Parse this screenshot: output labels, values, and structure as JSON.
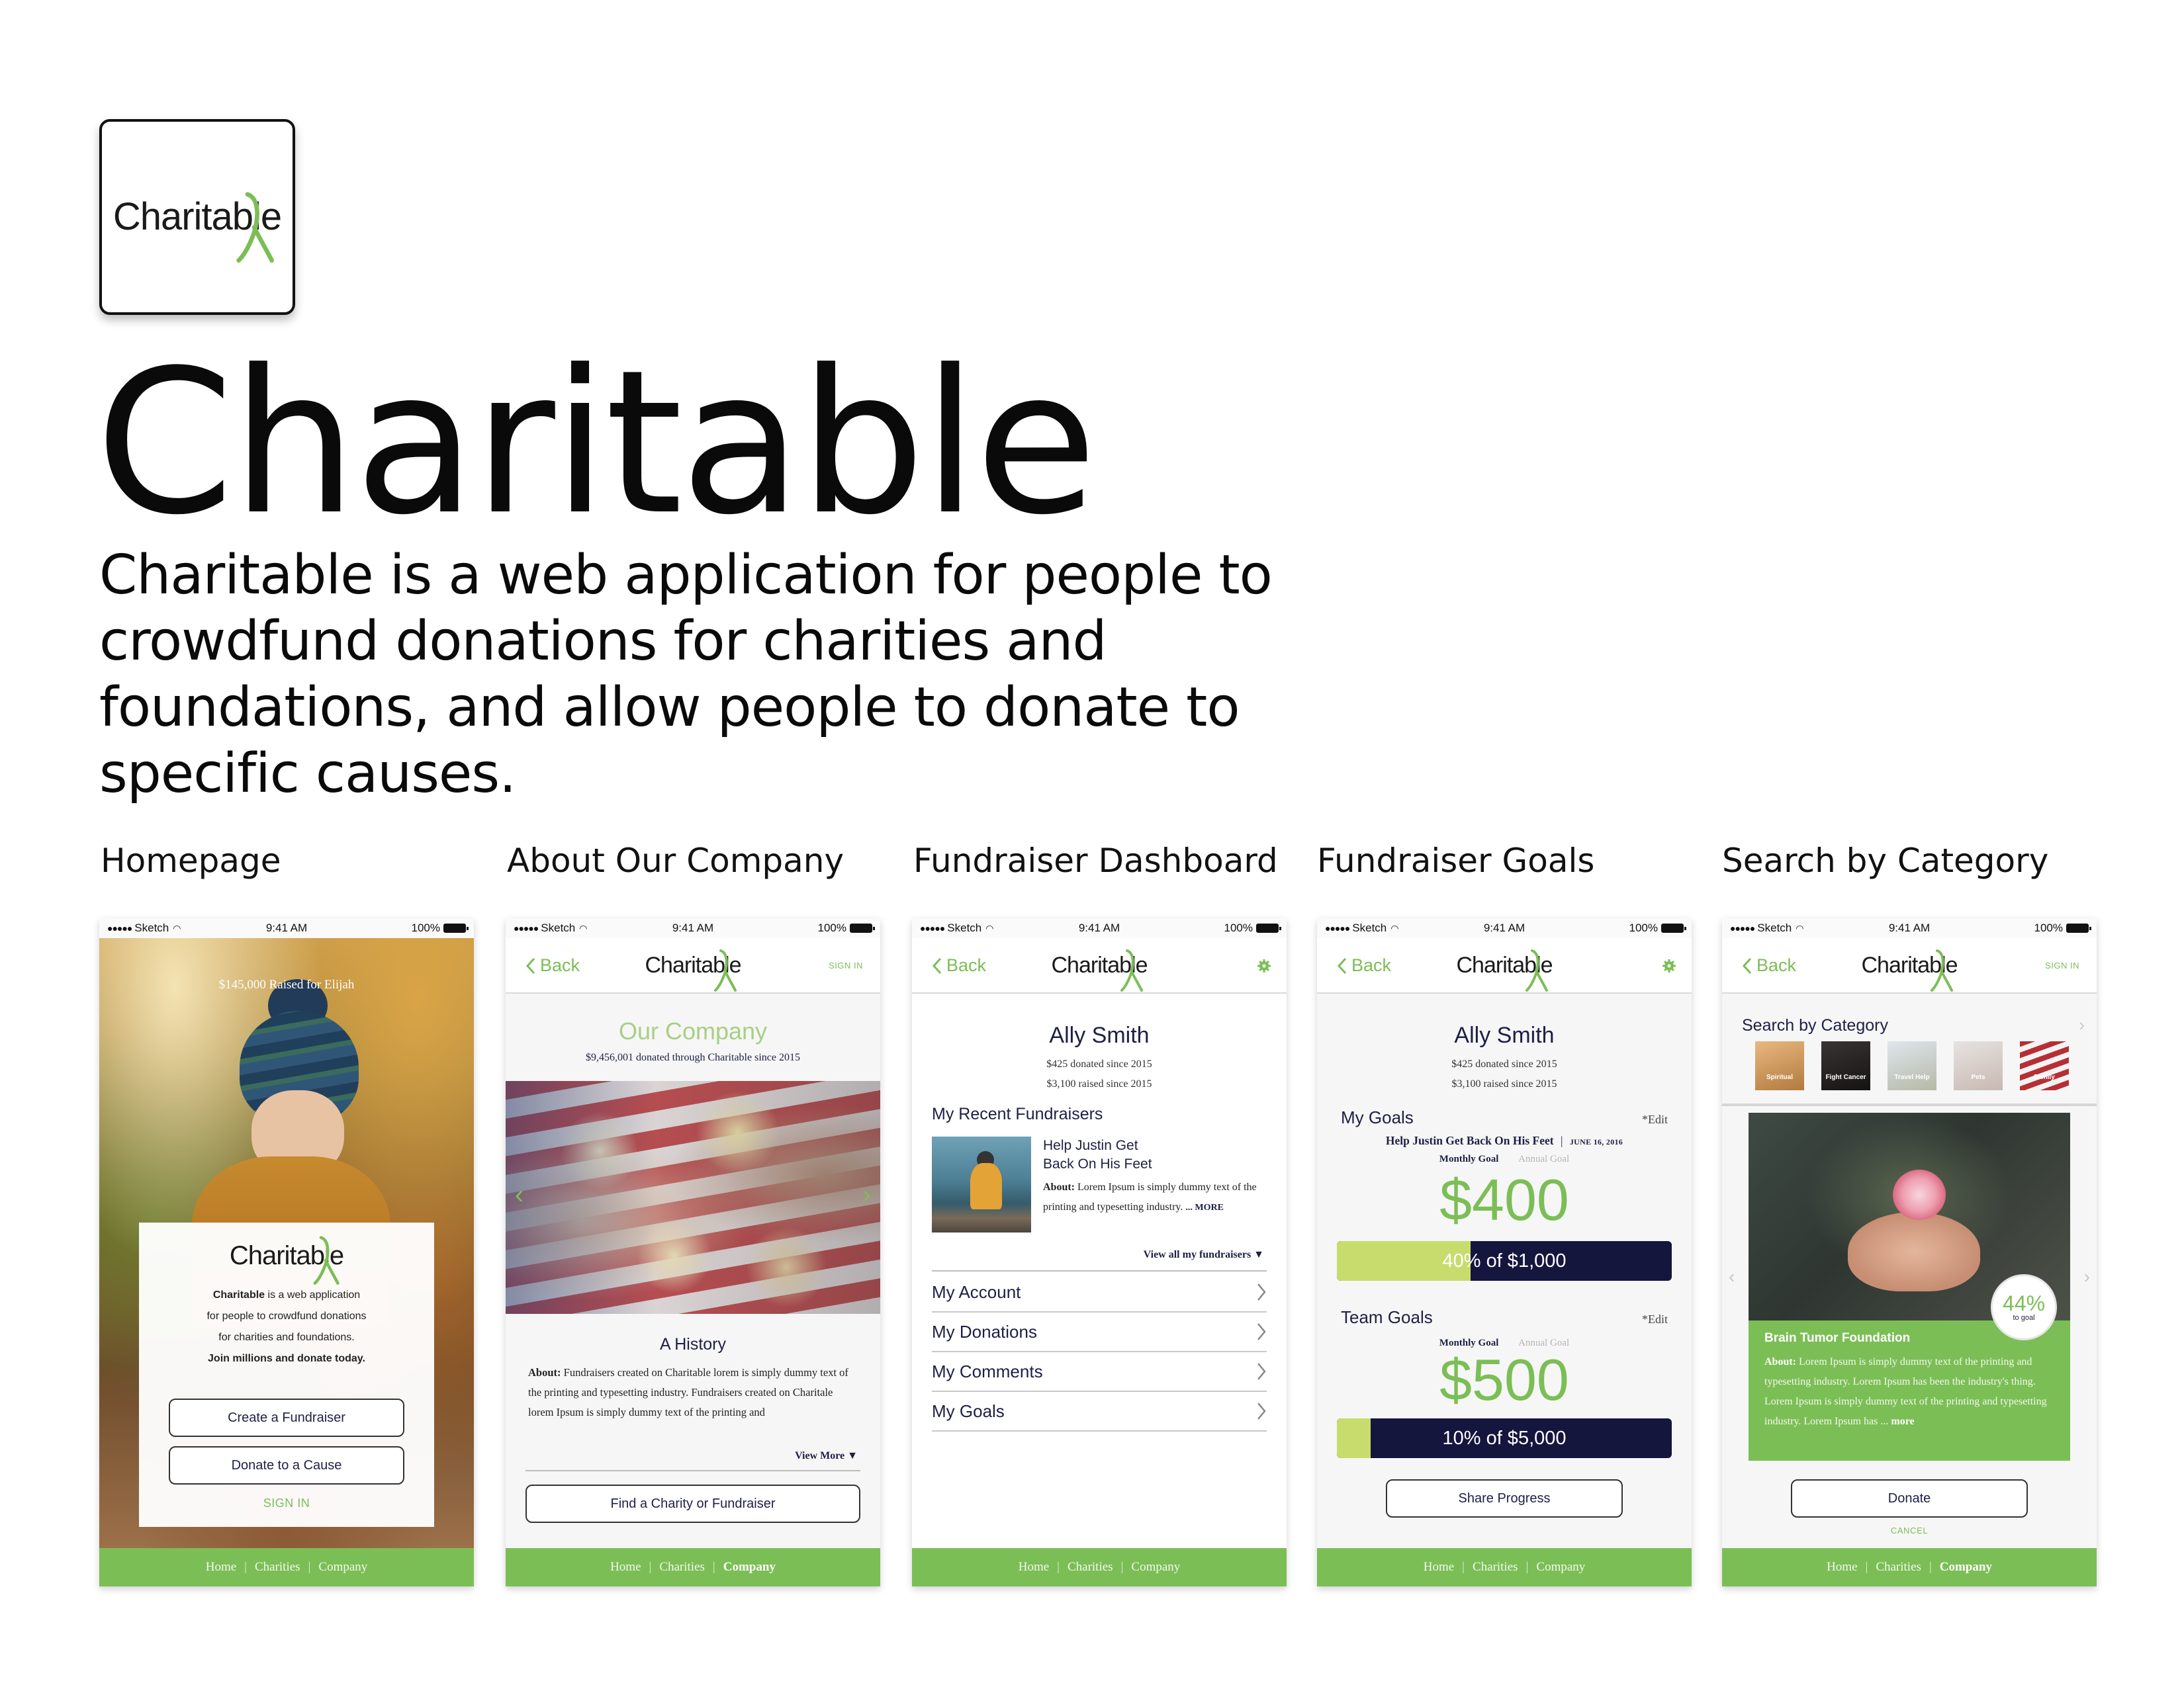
{
  "logo": {
    "word": "Charitable"
  },
  "hero": {
    "title": "Charitable",
    "description": "Charitable is a web application for people to crowdfund donations for charities and foundations, and allow people to donate to specific causes."
  },
  "status_bar": {
    "carrier": "Sketch",
    "time": "9:41 AM",
    "battery": "100%"
  },
  "nav": {
    "back": "Back",
    "sign_in": "SIGN IN"
  },
  "footer": {
    "home": "Home",
    "charities": "Charities",
    "company": "Company",
    "sep": "|"
  },
  "screens": [
    {
      "label": "Homepage",
      "raised": "$145,000 Raised for Elijah",
      "tagline_1": "Charitable",
      "tagline_2": "is a web application",
      "tagline_3": "for people to crowdfund donations",
      "tagline_4": "for charities and foundations.",
      "tagline_5": "Join millions and donate today.",
      "create_btn": "Create a Fundraiser",
      "donate_btn": "Donate to a Cause",
      "sign_in": "SIGN IN"
    },
    {
      "label": "About Our Company",
      "title": "Our Company",
      "subtitle": "$9,456,001 donated through Charitable since 2015",
      "section": "A History",
      "about_label": "About:",
      "about_text": "Fundraisers created on Charitable lorem is simply dummy text of the printing and typesetting industry. Fundraisers created on Charitale lorem Ipsum is simply dummy text of the printing and",
      "view_more": "View More ▼",
      "find_btn": "Find a Charity or Fundraiser"
    },
    {
      "label": "Fundraiser Dashboard",
      "name": "Ally Smith",
      "stat_1": "$425 donated since 2015",
      "stat_2": "$3,100 raised since 2015",
      "recent_head": "My Recent Fundraisers",
      "fund_title_1": "Help Justin Get",
      "fund_title_2": "Back On His Feet",
      "about_label": "About:",
      "about_text": "Lorem Ipsum is simply dummy text of the printing and typesetting industry.",
      "more": "... MORE",
      "view_all": "View all my fundraisers ▼",
      "menu": [
        "My Account",
        "My Donations",
        "My Comments",
        "My Goals"
      ]
    },
    {
      "label": "Fundraiser Goals",
      "name": "Ally Smith",
      "stat_1": "$425 donated since 2015",
      "stat_2": "$3,100 raised since 2015",
      "my_goals": "My Goals",
      "edit": "*Edit",
      "goal_title": "Help Justin Get Back On His Feet",
      "goal_sep": "|",
      "goal_date": "JUNE 16, 2016",
      "monthly": "Monthly Goal",
      "annual": "Annual Goal",
      "amount_1": "$400",
      "progress_1_text": "40% of $1,000",
      "progress_1": 0.4,
      "team_goals": "Team Goals",
      "amount_2": "$500",
      "progress_2_text": "10% of $5,000",
      "progress_2": 0.1,
      "share_btn": "Share Progress"
    },
    {
      "label": "Search by Category",
      "heading": "Search by Category",
      "categories": [
        "Spiritual",
        "Fight Cancer",
        "Travel Help",
        "Pets",
        "Family"
      ],
      "percent": "44%",
      "percent_sub": "to goal",
      "foundation": "Brain Tumor Foundation",
      "about_label": "About:",
      "about_text": "Lorem Ipsum is simply dummy text of the printing and typesetting industry. Lorem Ipsum has been the industry's thing. Lorem Ipsum is simply dummy text of the printing and typesetting industry. Lorem Ipsum has ...",
      "more": "more",
      "donate_btn": "Donate",
      "cancel": "CANCEL"
    }
  ],
  "colors": {
    "green": "#7cbe56",
    "navy": "#1e1f46",
    "lime": "#c8dc6e"
  }
}
